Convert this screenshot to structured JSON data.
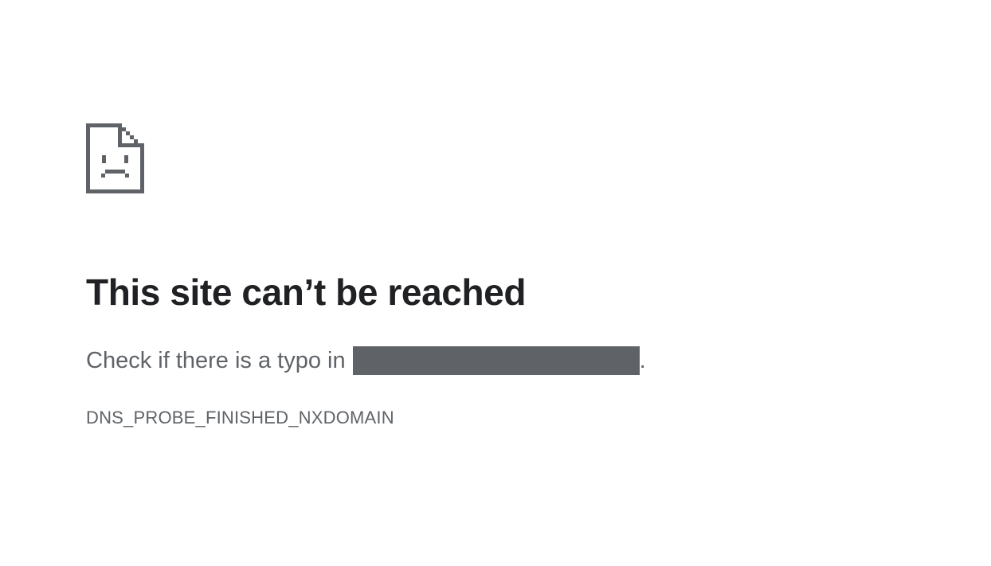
{
  "page": {
    "icon": "sad-document-icon",
    "title": "This site can’t be reached",
    "message_prefix": "Check if there is a typo in",
    "message_suffix": ".",
    "error_code": "DNS_PROBE_FINISHED_NXDOMAIN"
  },
  "colors": {
    "title": "#202124",
    "text": "#5f6368",
    "icon": "#5f6368",
    "redaction": "#5f6368",
    "background": "#ffffff"
  }
}
